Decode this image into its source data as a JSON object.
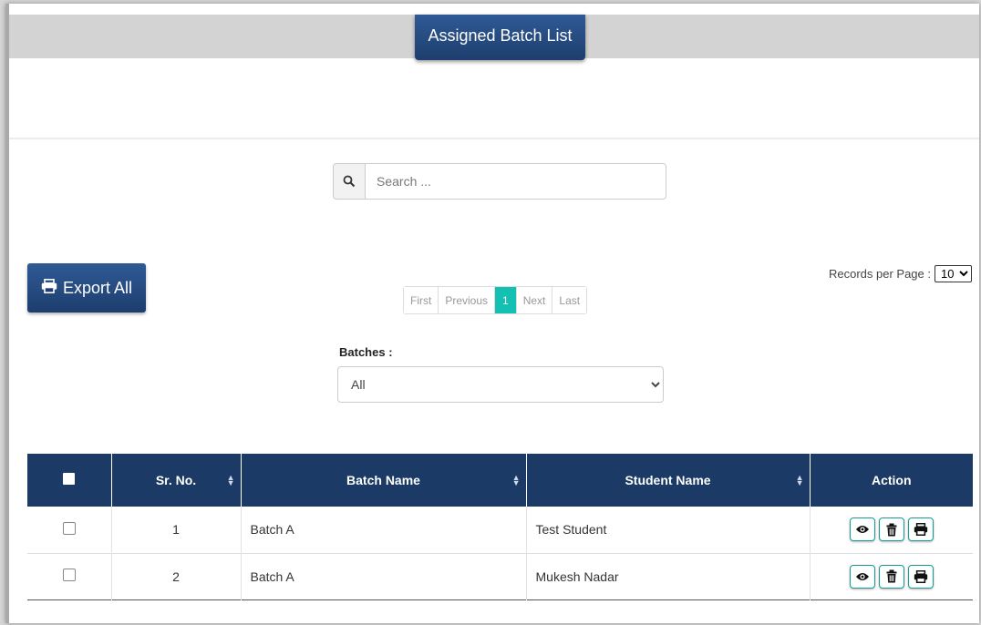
{
  "header": {
    "title": "Assigned Batch List"
  },
  "search": {
    "placeholder": "Search ..."
  },
  "toolbar": {
    "export_label": "Export All"
  },
  "records": {
    "label": "Records per Page :",
    "selected": "10"
  },
  "pagination": {
    "first": "First",
    "previous": "Previous",
    "current": "1",
    "next": "Next",
    "last": "Last"
  },
  "filter": {
    "label": "Batches :",
    "selected": "All"
  },
  "table": {
    "headers": {
      "sr_no": "Sr. No.",
      "batch_name": "Batch Name",
      "student_name": "Student Name",
      "action": "Action"
    },
    "rows": [
      {
        "sr_no": "1",
        "batch_name": "Batch A",
        "student_name": "Test Student"
      },
      {
        "sr_no": "2",
        "batch_name": "Batch A",
        "student_name": "Mukesh Nadar"
      }
    ]
  },
  "icons": {
    "search": "search-icon",
    "print": "printer-icon",
    "view": "eye-icon",
    "delete": "trash-icon"
  },
  "colors": {
    "primary": "#1d3e6e",
    "accent": "#13c0b1",
    "table_header": "#1c3a66"
  }
}
